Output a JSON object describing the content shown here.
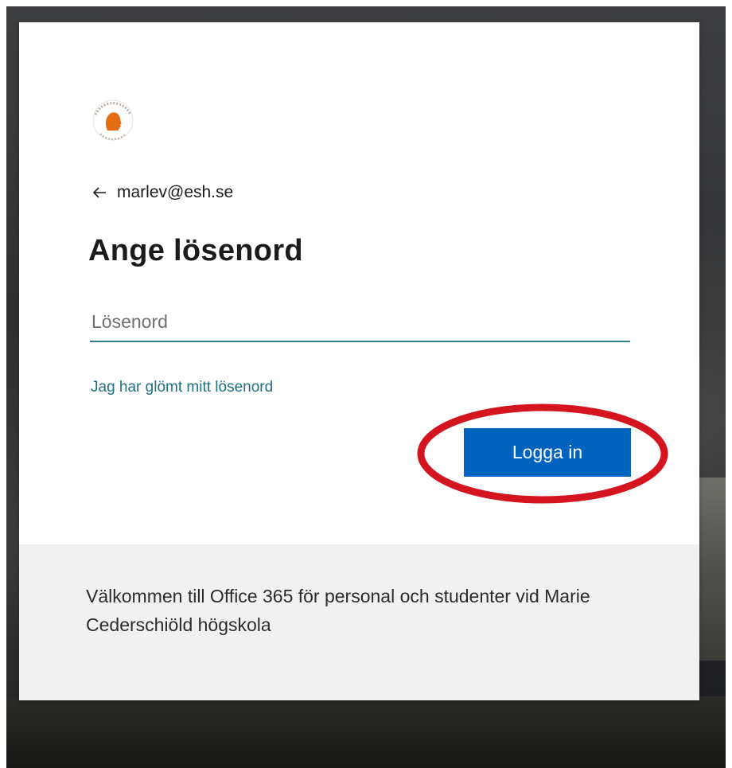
{
  "signin": {
    "email": "marlev@esh.se",
    "title": "Ange lösenord",
    "password_placeholder": "Lösenord",
    "password_value": "",
    "forgot_link": "Jag har glömt mitt lösenord",
    "signin_button": "Logga in",
    "back_icon": "back-arrow-icon",
    "logo_icon": "school-logo-icon"
  },
  "footer": {
    "welcome_text": "Välkommen till Office 365 för personal och studenter vid Marie Cederschiöld högskola"
  },
  "colors": {
    "button": "#0064bf",
    "link": "#1e6f82",
    "input_underline": "#2f7f88",
    "highlight": "#d4151f",
    "logo_orange": "#e46c13",
    "footer_bg": "#f1f1f2"
  }
}
